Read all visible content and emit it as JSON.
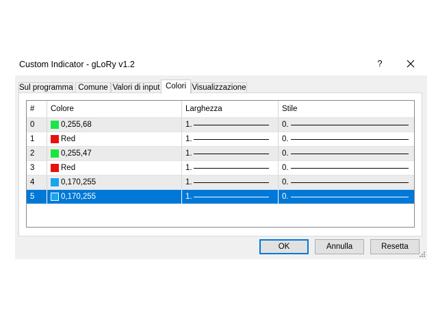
{
  "window": {
    "title": "Custom Indicator - gLoRy v1.2",
    "help_label": "?",
    "close_icon": "close-icon"
  },
  "tabs": [
    {
      "label": "Sul programma"
    },
    {
      "label": "Comune"
    },
    {
      "label": "Valori di input"
    },
    {
      "label": "Colori",
      "active": true
    },
    {
      "label": "Visualizzazione"
    }
  ],
  "grid": {
    "headers": [
      "#",
      "Colore",
      "Larghezza",
      "Stile"
    ],
    "rows": [
      {
        "index": "0",
        "color_label": "0,255,68",
        "swatch": "#19e64a",
        "width": "1.",
        "style": "0."
      },
      {
        "index": "1",
        "color_label": "Red",
        "swatch": "#e81010",
        "width": "1.",
        "style": "0."
      },
      {
        "index": "2",
        "color_label": "0,255,47",
        "swatch": "#19e63c",
        "width": "1.",
        "style": "0."
      },
      {
        "index": "3",
        "color_label": "Red",
        "swatch": "#e81010",
        "width": "1.",
        "style": "0."
      },
      {
        "index": "4",
        "color_label": "0,170,255",
        "swatch": "#1aa3ef",
        "width": "1.",
        "style": "0."
      },
      {
        "index": "5",
        "color_label": "0,170,255",
        "swatch": "#1aa3ef",
        "width": "1.",
        "style": "0.",
        "selected": true
      }
    ],
    "selected_color": "#0078d7"
  },
  "buttons": {
    "ok": "OK",
    "cancel": "Annulla",
    "reset": "Resetta"
  }
}
